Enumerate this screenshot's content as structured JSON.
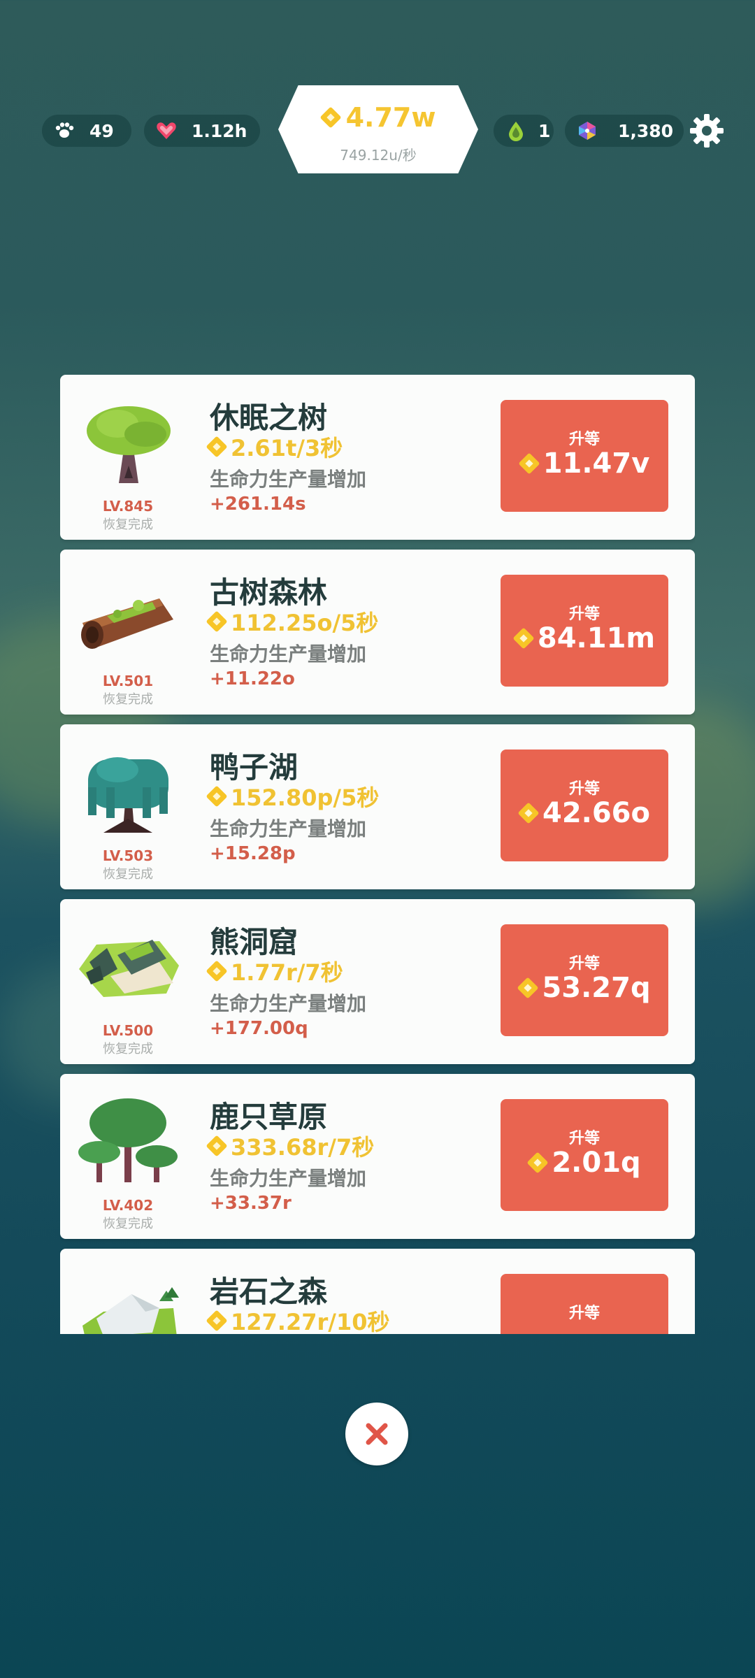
{
  "hud": {
    "paw_count": "49",
    "hearts": "1.12h",
    "coins": "4.77w",
    "coin_rate": "749.12u/秒",
    "drops": "1",
    "gems": "1,380"
  },
  "button_label": "升等",
  "items": [
    {
      "name": "休眠之树",
      "rate": "2.61t/3秒",
      "desc": "生命力生产量增加",
      "increase": "+261.14s",
      "level": "LV.845",
      "status": "恢复完成",
      "cost": "11.47v",
      "thumb": "tree-icon"
    },
    {
      "name": "古树森林",
      "rate": "112.25o/5秒",
      "desc": "生命力生产量增加",
      "increase": "+11.22o",
      "level": "LV.501",
      "status": "恢复完成",
      "cost": "84.11m",
      "thumb": "log-icon"
    },
    {
      "name": "鸭子湖",
      "rate": "152.80p/5秒",
      "desc": "生命力生产量增加",
      "increase": "+15.28p",
      "level": "LV.503",
      "status": "恢复完成",
      "cost": "42.66o",
      "thumb": "willow-icon"
    },
    {
      "name": "熊洞窟",
      "rate": "1.77r/7秒",
      "desc": "生命力生产量增加",
      "increase": "+177.00q",
      "level": "LV.500",
      "status": "恢复完成",
      "cost": "53.27q",
      "thumb": "cave-icon"
    },
    {
      "name": "鹿只草原",
      "rate": "333.68r/7秒",
      "desc": "生命力生产量增加",
      "increase": "+33.37r",
      "level": "LV.402",
      "status": "恢复完成",
      "cost": "2.01q",
      "thumb": "trees-icon"
    },
    {
      "name": "岩石之森",
      "rate": "127.27r/10秒",
      "desc": "",
      "increase": "",
      "level": "",
      "status": "",
      "cost": "",
      "thumb": "rock-icon"
    }
  ],
  "colors": {
    "accent": "#e96450",
    "coin": "#f5c531",
    "level": "#d35e4a"
  }
}
